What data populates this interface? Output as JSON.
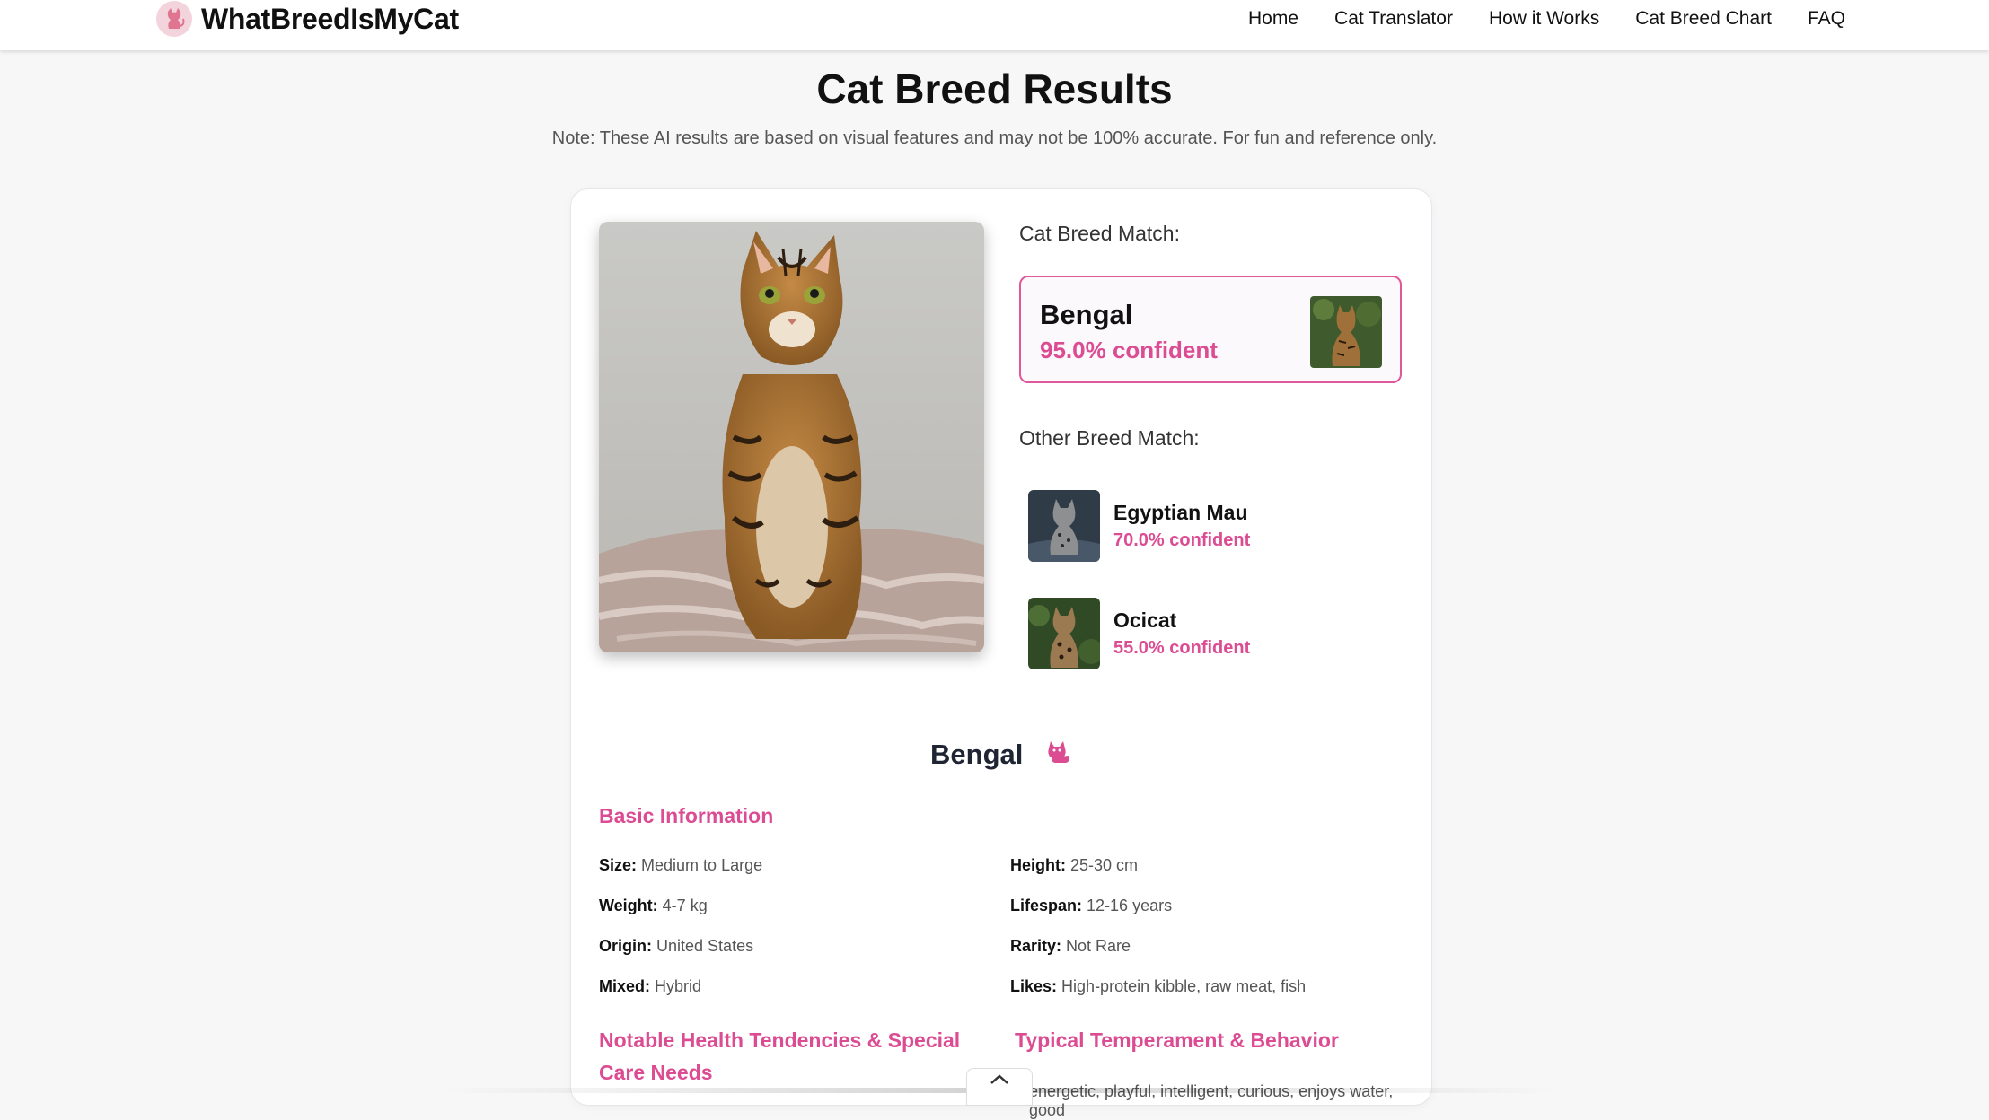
{
  "header": {
    "brand": "WhatBreedIsMyCat",
    "nav": [
      "Home",
      "Cat Translator",
      "How it Works",
      "Cat Breed Chart",
      "FAQ"
    ]
  },
  "page": {
    "title": "Cat Breed Results",
    "note": "Note: These AI results are based on visual features and may not be 100% accurate. For fun and reference only."
  },
  "results": {
    "match_label": "Cat Breed Match:",
    "top_match": {
      "name": "Bengal",
      "confidence": "95.0% confident"
    },
    "other_label": "Other Breed Match:",
    "others": [
      {
        "name": "Egyptian Mau",
        "confidence": "70.0% confident"
      },
      {
        "name": "Ocicat",
        "confidence": "55.0% confident"
      }
    ]
  },
  "details": {
    "breed": "Bengal",
    "basic_title": "Basic Information",
    "basic": [
      {
        "label": "Size:",
        "value": "Medium to Large"
      },
      {
        "label": "Height:",
        "value": "25-30 cm"
      },
      {
        "label": "Weight:",
        "value": "4-7 kg"
      },
      {
        "label": "Lifespan:",
        "value": "12-16 years"
      },
      {
        "label": "Origin:",
        "value": "United States"
      },
      {
        "label": "Rarity:",
        "value": "Not Rare"
      },
      {
        "label": "Mixed:",
        "value": "Hybrid"
      },
      {
        "label": "Likes:",
        "value": "High-protein kibble, raw meat, fish"
      }
    ],
    "health_title": "Notable Health Tendencies & Special Care Needs",
    "temperament_title": "Typical Temperament & Behavior",
    "temperament_text": "energetic, playful, intelligent, curious, enjoys water, good"
  },
  "colors": {
    "accent": "#dc4c93",
    "heading": "#1f2533"
  }
}
